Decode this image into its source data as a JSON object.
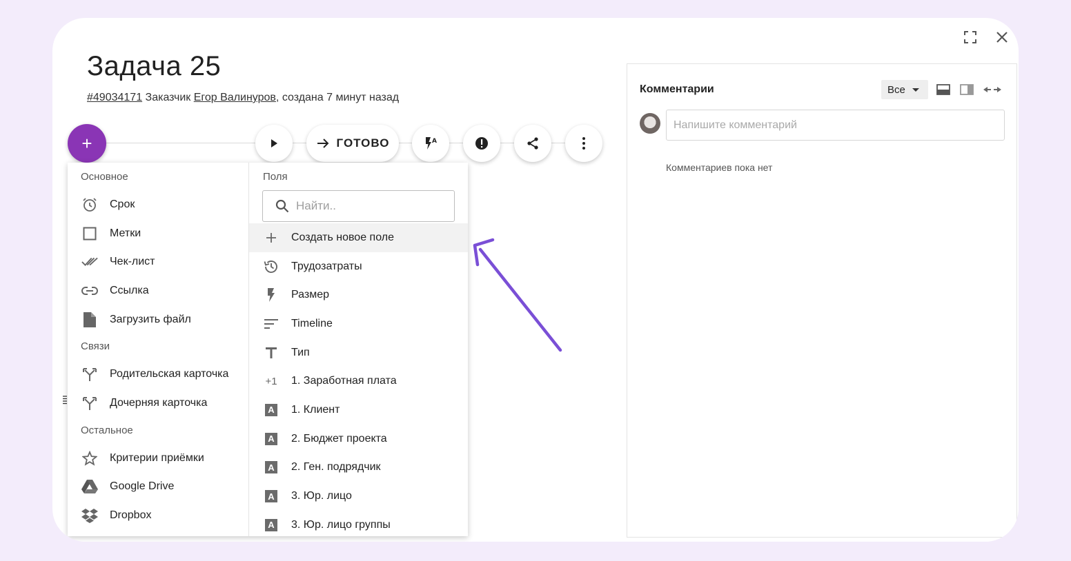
{
  "task": {
    "title": "Задача 25",
    "id_link": "#49034171",
    "customer_label": "Заказчик",
    "customer_name": "Егор Валинуров",
    "created": ", создана 7 минут назад"
  },
  "toolbar": {
    "plus": "+",
    "done_label": "ГОТОВО"
  },
  "menu": {
    "main_section": "Основное",
    "main_items": [
      "Срок",
      "Метки",
      "Чек-лист",
      "Ссылка",
      "Загрузить файл"
    ],
    "links_section": "Связи",
    "links_items": [
      "Родительская карточка",
      "Дочерняя карточка"
    ],
    "other_section": "Остальное",
    "other_items": [
      "Критерии приёмки",
      "Google Drive",
      "Dropbox"
    ],
    "fields_section": "Поля",
    "search_placeholder": "Найти..",
    "create_field": "Создать новое поле",
    "fields": [
      "Трудозатраты",
      "Размер",
      "Timeline",
      "Тип",
      "1. Заработная плата",
      "1. Клиент",
      "2. Бюджет проекта",
      "2. Ген. подрядчик",
      "3. Юр. лицо",
      "3. Юр. лицо группы"
    ]
  },
  "comments": {
    "title": "Комментарии",
    "filter": "Все",
    "input_placeholder": "Напишите комментарий",
    "empty": "Комментариев пока нет"
  },
  "colors": {
    "accent": "#8a35b5",
    "annotation_arrow": "#7a4fd6",
    "background": "#f3ecfb"
  }
}
